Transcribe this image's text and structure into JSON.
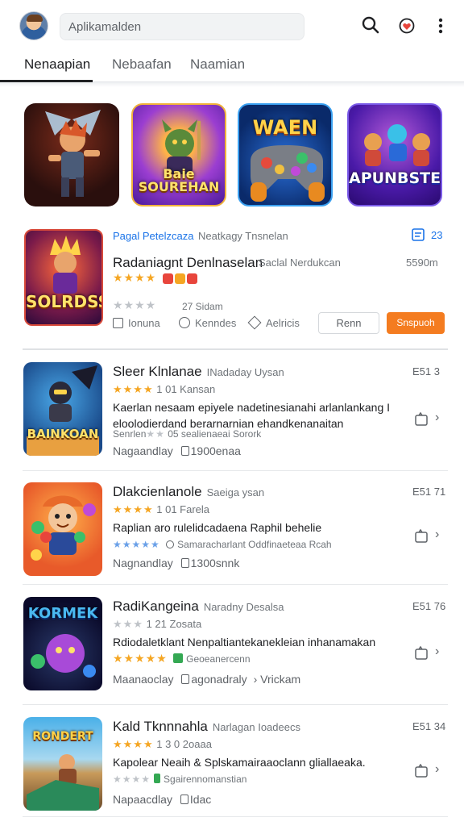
{
  "search": {
    "placeholder": "Aplikamalden"
  },
  "tabs": [
    "Nenaapian",
    "Nebaafan",
    "Naamian"
  ],
  "featured": [
    {
      "caption": ""
    },
    {
      "caption": "Baie SOUREHAN"
    },
    {
      "caption": "WAEN"
    },
    {
      "caption": "APUNBSTE"
    }
  ],
  "main_app": {
    "meta": "Pagal Petelzcaza",
    "meta_rest": "Neatkagy Tnsnelan",
    "meta_count": "23",
    "title": "Radaniagnt Denlnaselan",
    "title_sub": "Saclal Nerdukcan",
    "price": "5590m",
    "icon_caption": "SOLRDSS",
    "rating_text": "27 Sidam",
    "actions": [
      "Ionuna",
      "Kenndes",
      "Aelricis"
    ],
    "btn_outline": "Renn",
    "btn_primary": "Snspuoh"
  },
  "items": [
    {
      "name": "Sleer Klnlanae",
      "sub": "INadaday Uysan",
      "price": "E51 3",
      "rating_label": "1 01 Kansan",
      "desc1": "Kaerlan nesaam epiyele nadetinesianahi arlanlankang I",
      "desc2": "eloolodierdand berarnarnian ehandkenanaitan",
      "r2": "Senrlen",
      "r2b": "05 sealienaeai Sorork",
      "foot": "Nagaandlay",
      "foot2": "1900enaa",
      "icon_caption": "BAINKOAN"
    },
    {
      "name": "Dlakcienlanole",
      "sub": "Saeiga ysan",
      "price": "E51 71",
      "rating_label": "1 01 Farela",
      "desc1": "Raplian aro rulelidcadaena Raphil behelie",
      "desc2": "",
      "r2": "",
      "r2b": "Samaracharlant Oddfinaeteaa Rcah",
      "foot": "Nagnandlay",
      "foot2": "1300snnk",
      "icon_caption": ""
    },
    {
      "name": "RadiKangeina",
      "sub": "Naradny Desalsa",
      "price": "E51 76",
      "rating_label": "1 21 Zosata",
      "desc1": "Rdiodaletklant Nenpaltiantekanekleian inhanamakan",
      "desc2": "",
      "r2": "",
      "r2b": "Geoeanercenn",
      "foot": "Maanaoclay",
      "foot2": "agonadraly",
      "foot3": "Vrickam",
      "icon_caption": "KORMEK"
    },
    {
      "name": "Kald Tknnnahla",
      "sub": "Narlagan Ioadeecs",
      "price": "E51 34",
      "rating_label": "1 3 0 2oaaa",
      "desc1": "Kapolear Neaih & Splskamairaaoclann gliallaeaka.",
      "desc2": "",
      "r2": "",
      "r2b": "Sgairennomanstian",
      "foot": "Napaacdlay",
      "foot2": "Idac",
      "icon_caption": "RONDERT"
    }
  ]
}
